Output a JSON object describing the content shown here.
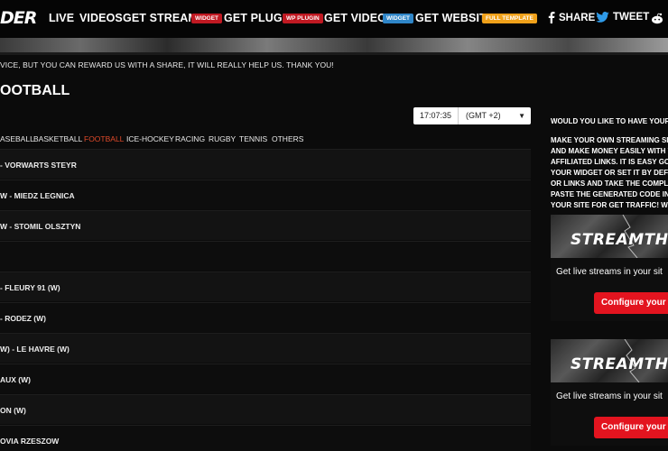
{
  "logo": {
    "text": "DER"
  },
  "nav": {
    "live": "LIVE",
    "videos": "VIDEOS",
    "get_streams": "GET STREAMS",
    "get_streams_badge": "WIDGET",
    "get_plugin": "GET PLUGIN",
    "get_plugin_badge": "WP PLUGIN",
    "get_videos": "GET VIDEOS",
    "get_videos_badge": "WIDGET",
    "get_website": "GET WEBSITE",
    "get_website_badge": "FULL TEMPLATE",
    "share": "SHARE",
    "tweet": "TWEET"
  },
  "colors": {
    "badge_red": "#c01922",
    "badge_blue": "#2f86c8",
    "badge_orange": "#f0a11a",
    "active_tab": "#e04a2a",
    "button_red": "#e3141f"
  },
  "notice": "VICE, BUT YOU CAN REWARD US WITH A SHARE, IT WILL REALLY HELP US. THANK YOU!",
  "section_title": "OOTBALL",
  "clock": {
    "time": "17:07:35",
    "timezone": "(GMT +2)"
  },
  "tabs": [
    "ASEBALL",
    "BASKETBALL",
    "FOOTBALL",
    "ICE-HOCKEY",
    "RACING",
    "RUGBY",
    "TENNIS",
    "OTHERS"
  ],
  "active_tab": "FOOTBALL",
  "matches": [
    "- VORWARTS STEYR",
    "W - MIEDZ LEGNICA",
    "W - STOMIL OLSZTYN",
    "",
    "- FLEURY 91 (W)",
    "- RODEZ (W)",
    "W) - LE HAVRE (W)",
    "AUX (W)",
    "ON (W)",
    "OVIA RZESZOW"
  ],
  "sidebar": {
    "question": "WOULD YOU LIKE TO HAVE YOUR OW",
    "text_lines": [
      "MAKE YOUR OWN STREAMING SITE",
      "AND MAKE MONEY EASILY WITH YO",
      "AFFILIATED LINKS. IT IS EASY GO TO",
      "YOUR WIDGET OR SET IT BY DEFAUL",
      "OR LINKS AND TAKE THE COMPLETI",
      "PASTE THE GENERATED CODE IN YO",
      "YOUR SITE FOR GET TRAFFIC! WE'LL"
    ],
    "promos": [
      {
        "logo": "STREAMTH",
        "subtitle": "Get live streams in your sit",
        "button": "Configure your"
      },
      {
        "logo": "STREAMTH",
        "subtitle": "Get live streams in your sit",
        "button": "Configure your"
      }
    ]
  }
}
